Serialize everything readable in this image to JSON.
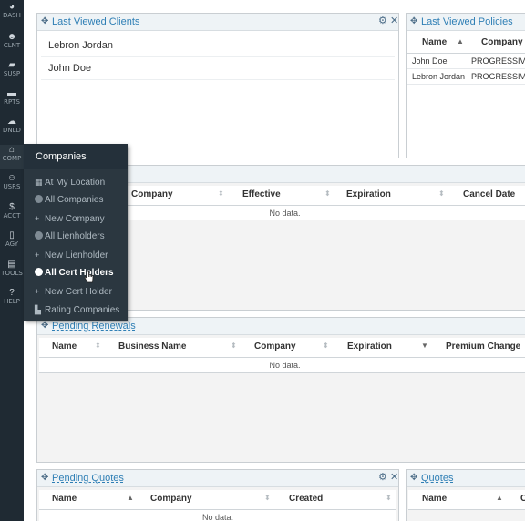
{
  "sidebar": {
    "items": [
      {
        "label": "DASH",
        "icon": "dashboard-icon",
        "glyph": "◕"
      },
      {
        "label": "CLNT",
        "icon": "client-icon",
        "glyph": "☻"
      },
      {
        "label": "SUSP",
        "icon": "suspense-icon",
        "glyph": "▰"
      },
      {
        "label": "RPTS",
        "icon": "reports-icon",
        "glyph": "▬"
      },
      {
        "label": "DNLD",
        "icon": "download-icon",
        "glyph": "☁"
      },
      {
        "label": "COMP",
        "icon": "companies-icon",
        "glyph": "⌂"
      },
      {
        "label": "USRS",
        "icon": "users-icon",
        "glyph": "☺"
      },
      {
        "label": "ACCT",
        "icon": "dollar-icon",
        "glyph": "$"
      },
      {
        "label": "AGY",
        "icon": "agency-icon",
        "glyph": "▯"
      },
      {
        "label": "TOOLS",
        "icon": "tools-icon",
        "glyph": "▤"
      },
      {
        "label": "HELP",
        "icon": "help-icon",
        "glyph": "?"
      }
    ]
  },
  "companies_menu": {
    "title": "Companies",
    "items": [
      {
        "label": "At My Location",
        "icon": "building-icon",
        "glyph": "▦"
      },
      {
        "label": "All Companies",
        "icon": "circle-icon",
        "glyph": "dot"
      },
      {
        "label": "New Company",
        "icon": "plus-icon",
        "glyph": "+"
      },
      {
        "label": "All Lienholders",
        "icon": "circle-icon",
        "glyph": "dot"
      },
      {
        "label": "New Lienholder",
        "icon": "plus-icon",
        "glyph": "+"
      },
      {
        "label": "All Cert Holders",
        "icon": "circle-icon",
        "glyph": "dot"
      },
      {
        "label": "New Cert Holder",
        "icon": "plus-icon",
        "glyph": "+"
      },
      {
        "label": "Rating Companies",
        "icon": "chart-icon",
        "glyph": "▙"
      }
    ]
  },
  "last_viewed_clients": {
    "title": "Last Viewed Clients",
    "clients": [
      "Lebron Jordan",
      "John Doe"
    ]
  },
  "last_viewed_policies": {
    "title": "Last Viewed Policies",
    "columns": [
      "Name",
      "Company"
    ],
    "rows": [
      {
        "name": "John Doe",
        "company": "PROGRESSIVE"
      },
      {
        "name": "Lebron Jordan",
        "company": "PROGRESSIVE"
      }
    ]
  },
  "middle_widget": {
    "columns": [
      "Company",
      "Effective",
      "Expiration",
      "Cancel Date"
    ],
    "empty_text": "No data."
  },
  "pending_renewals": {
    "title": "Pending Renewals",
    "columns": [
      "Name",
      "Business Name",
      "Company",
      "Expiration",
      "Premium Change"
    ],
    "empty_text": "No data."
  },
  "pending_quotes": {
    "title": "Pending Quotes",
    "columns": [
      "Name",
      "Company",
      "Created"
    ],
    "empty_text": "No data."
  },
  "quotes": {
    "title": "Quotes",
    "columns": [
      "Name",
      "C"
    ]
  },
  "icons": {
    "move": "✥",
    "settings": "⚙",
    "close": "✕"
  },
  "colors": {
    "rail": "#1f2a33",
    "flyout": "#2b3740",
    "link": "#2f7fb5",
    "widget_header": "#eef3f6"
  }
}
